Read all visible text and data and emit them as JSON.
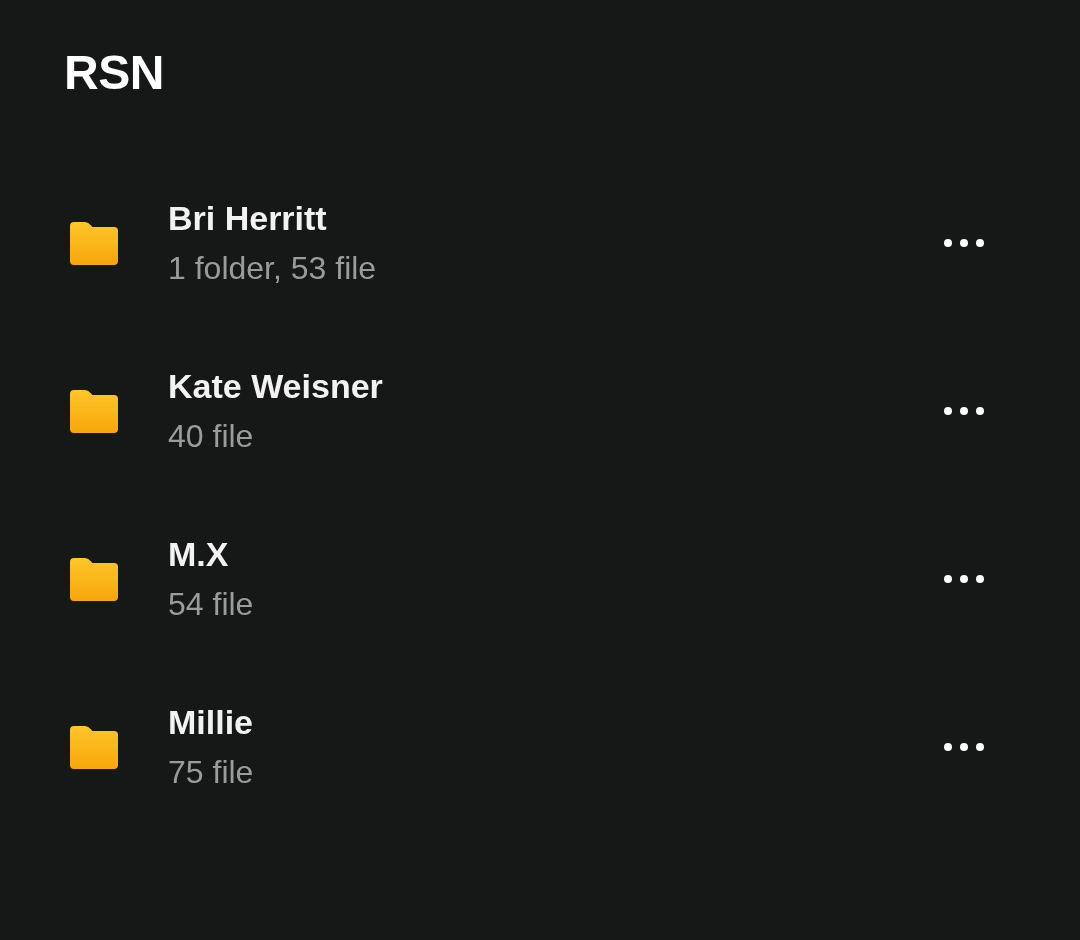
{
  "title": "RSN",
  "folders": [
    {
      "name": "Bri Herritt",
      "details": "1 folder, 53 file"
    },
    {
      "name": "Kate Weisner",
      "details": "40 file"
    },
    {
      "name": "M.X",
      "details": "54 file"
    },
    {
      "name": "Millie",
      "details": "75 file"
    }
  ]
}
